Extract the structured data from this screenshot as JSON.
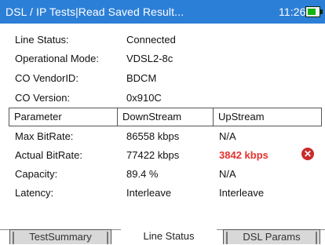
{
  "titlebar": {
    "title": "DSL / IP Tests|Read Saved Result...",
    "time": "11:26",
    "battery_icon": "battery-charging-icon",
    "battery_level": 0.85
  },
  "info": [
    {
      "label": "Line Status:",
      "value": "Connected"
    },
    {
      "label": "Operational Mode:",
      "value": "VDSL2-8c"
    },
    {
      "label": "CO VendorID:",
      "value": "BDCM"
    },
    {
      "label": "CO Version:",
      "value": "0x910C"
    }
  ],
  "table": {
    "headers": [
      "Parameter",
      "DownStream",
      "UpStream"
    ],
    "rows": [
      {
        "parameter": "Max BitRate:",
        "downstream": "86558  kbps",
        "upstream": "N/A"
      },
      {
        "parameter": "Actual BitRate:",
        "downstream": "77422  kbps",
        "upstream": "3842  kbps",
        "upstream_status": "fail",
        "status_icon": "error-x-icon"
      },
      {
        "parameter": "Capacity:",
        "downstream": "89.4  %",
        "upstream": "N/A"
      },
      {
        "parameter": "Latency:",
        "downstream": "Interleave",
        "upstream": "Interleave"
      }
    ],
    "fail_color": "#e4312d"
  },
  "tabs": [
    {
      "label": "TestSummary",
      "active": false
    },
    {
      "label": "Line Status",
      "active": true
    },
    {
      "label": "DSL Params",
      "active": false
    }
  ]
}
